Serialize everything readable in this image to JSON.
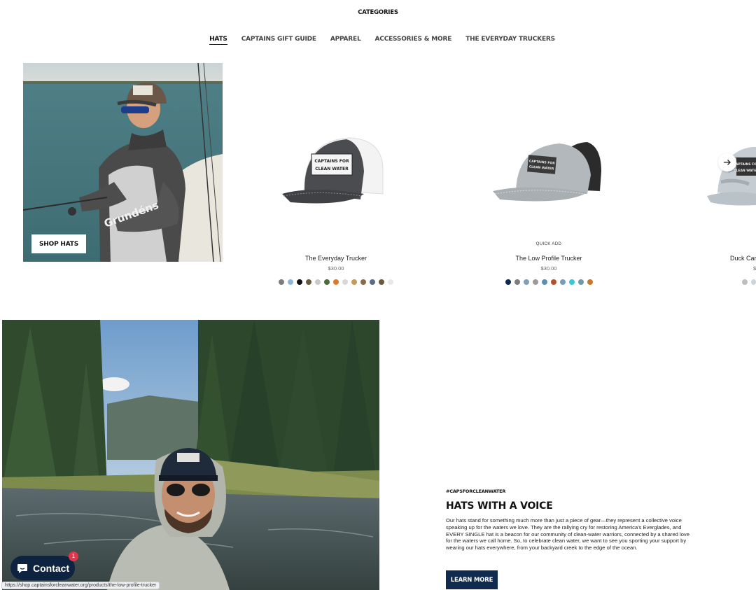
{
  "header": {
    "categories_label": "CATEGORIES",
    "tabs": [
      {
        "label": "HATS",
        "active": true
      },
      {
        "label": "CAPTAINS GIFT GUIDE"
      },
      {
        "label": "APPAREL"
      },
      {
        "label": "ACCESSORIES & MORE"
      },
      {
        "label": "THE EVERYDAY TRUCKERS"
      }
    ]
  },
  "hero": {
    "shop_button": "SHOP HATS"
  },
  "products": [
    {
      "name": "The Everyday Trucker",
      "price": "$30.00",
      "quick_add": "",
      "swatches": [
        "#7d7d7d",
        "#8fb6d6",
        "#111111",
        "#6b5b3e",
        "#c9c9c9",
        "#4e6b3a",
        "#e07a2a",
        "#d8d8d8",
        "#c89a55",
        "#8a6a4a",
        "#5a6b8a",
        "#6a5a3a",
        "#e8e8e8"
      ]
    },
    {
      "name": "The Low Profile Trucker",
      "price": "$30.00",
      "quick_add": "QUICK ADD",
      "swatches": [
        "#0f2a4a",
        "#7d7d7d",
        "#7fa0b8",
        "#9a9a9a",
        "#5a8fb0",
        "#b5502d",
        "#7a9cb3",
        "#38c7d8",
        "#6f99a8",
        "#c9782a"
      ]
    },
    {
      "name": "Duck Car",
      "price": "$",
      "swatches": [
        "#bfbfbf",
        "#c9d6dc"
      ]
    }
  ],
  "hat_logo_text": [
    "CAPTAINS FOR",
    "CLEAN WATER"
  ],
  "promo": {
    "tag": "#CAPSFORCLEANWATER",
    "title": "HATS WITH A VOICE",
    "body": "Our hats stand for something much more than just a piece of gear—they represent a collective voice speaking up for the waters we love. They are the rallying cry for restoring America's Everglades, and EVERY SINGLE hat is a beacon for our community of clean-water warriors, connected by a shared love for the waters we call home. So, to celebrate clean water, we want to see you sporting your support by wearing our hats everywhere, from your backyard creek to the edge of the ocean.",
    "button": "LEARN MORE"
  },
  "contact_widget": {
    "label": "Contact",
    "badge": "1"
  },
  "status_bar": {
    "url": "https://shop.captainsforcleanwater.org/products/the-low-profile-trucker"
  }
}
